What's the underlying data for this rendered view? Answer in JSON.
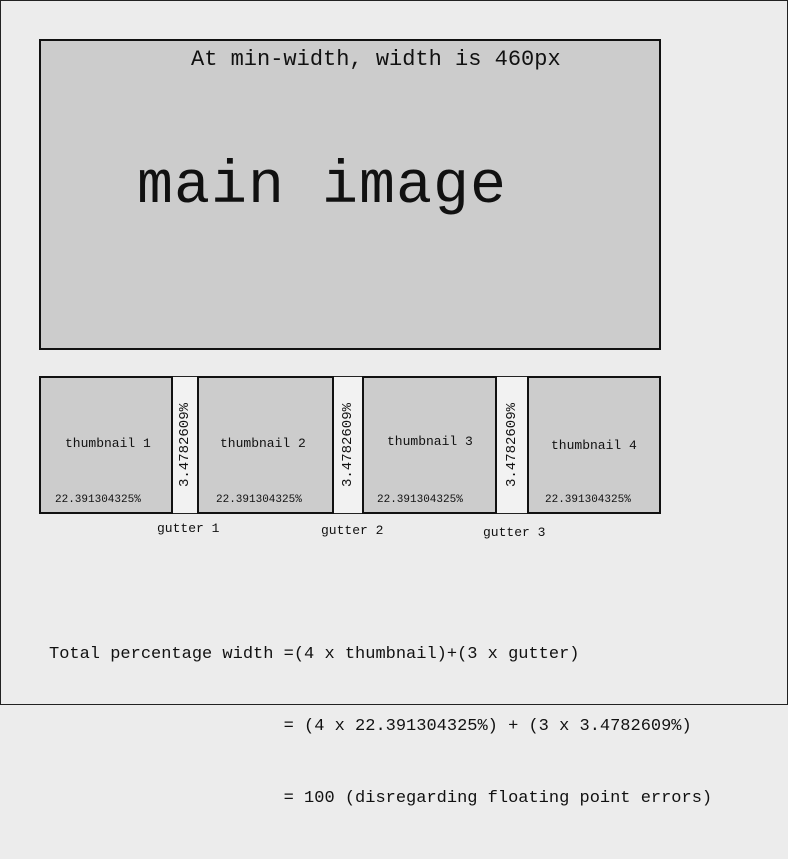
{
  "main": {
    "caption": "At min-width, width is 460px",
    "label": "main image"
  },
  "thumbnails": [
    {
      "label": "thumbnail 1",
      "percent": "22.391304325%"
    },
    {
      "label": "thumbnail 2",
      "percent": "22.391304325%"
    },
    {
      "label": "thumbnail 3",
      "percent": "22.391304325%"
    },
    {
      "label": "thumbnail 4",
      "percent": "22.391304325%"
    }
  ],
  "gutters": [
    {
      "value": "3.4782609%",
      "label": "gutter 1"
    },
    {
      "value": "3.4782609%",
      "label": "gutter 2"
    },
    {
      "value": "3.4782609%",
      "label": "gutter 3"
    }
  ],
  "formula": {
    "line1": "Total percentage width =(4 x thumbnail)+(3 x gutter)",
    "line2": "                       = (4 x 22.391304325%) + (3 x 3.4782609%)",
    "line3": "                       = 100 (disregarding floating point errors)"
  }
}
